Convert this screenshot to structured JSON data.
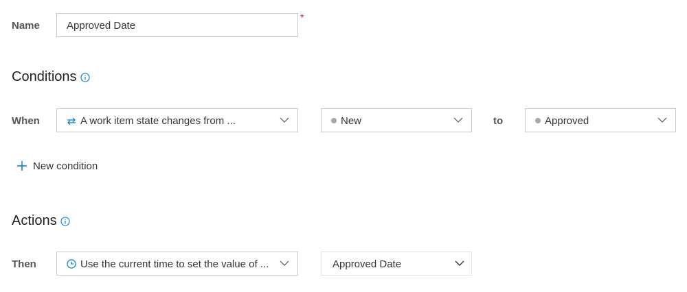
{
  "name_row": {
    "label": "Name",
    "input_value": "Approved Date",
    "required_marker": "*"
  },
  "conditions": {
    "title": "Conditions",
    "info_icon": "info-icon",
    "when_label": "When",
    "trigger_dropdown": {
      "icon": "swap-arrows-icon",
      "value": "A work item state changes from ..."
    },
    "from_state": {
      "value": "New",
      "dot_color": "#a6a6a6"
    },
    "to_label": "to",
    "to_state": {
      "value": "Approved",
      "dot_color": "#a6a6a6"
    },
    "new_condition": {
      "icon": "plus-icon",
      "label": "New condition",
      "accent": "#0078d4"
    }
  },
  "actions": {
    "title": "Actions",
    "info_icon": "info-icon",
    "then_label": "Then",
    "action_dropdown": {
      "icon": "clock-icon",
      "value": "Use the current time to set the value of ..."
    },
    "field_dropdown": {
      "value": "Approved Date"
    }
  },
  "colors": {
    "accent": "#0078d4",
    "required": "#a4262c",
    "border": "#c8c8c8"
  }
}
